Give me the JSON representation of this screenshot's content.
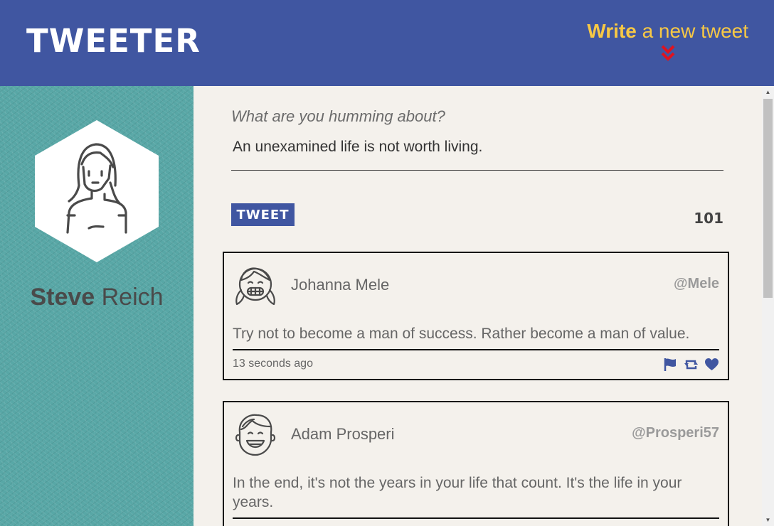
{
  "nav": {
    "brand": "TWEETER",
    "compose_bold": "Write",
    "compose_rest": " a new tweet"
  },
  "profile": {
    "first_name": "Steve",
    "last_name": " Reich"
  },
  "composer": {
    "prompt": "What are you humming about?",
    "text": "An unexamined life is not worth living.",
    "button_label": "TWEET",
    "counter": "101"
  },
  "tweets": [
    {
      "name": "Johanna Mele",
      "handle": "@Mele",
      "text": "Try not to become a man of success. Rather become a man of value.",
      "time": "13 seconds ago"
    },
    {
      "name": "Adam Prosperi",
      "handle": "@Prosperi57",
      "text": "In the end, it's not the years in your life that count. It's the life in your years.",
      "time": ""
    }
  ],
  "colors": {
    "nav_bg": "#4056a1",
    "accent": "#f7c845",
    "chevron": "#e0131f",
    "sidebar": "#58a7a6",
    "panel": "#f4f1ec"
  },
  "icons": [
    "chevron-double-down-icon",
    "flag-icon",
    "retweet-icon",
    "heart-icon"
  ]
}
